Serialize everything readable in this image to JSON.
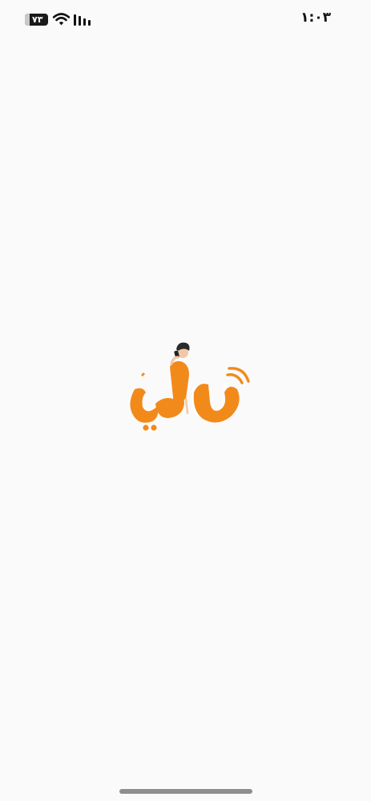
{
  "status_bar": {
    "battery_level": "٧٣",
    "time": "١:٠٣",
    "icons": [
      "battery-icon",
      "wifi-icon",
      "cellular-signal-icon"
    ]
  },
  "logo": {
    "icon": "ringly-logo-icon",
    "brand_color": "#f28a1a"
  }
}
